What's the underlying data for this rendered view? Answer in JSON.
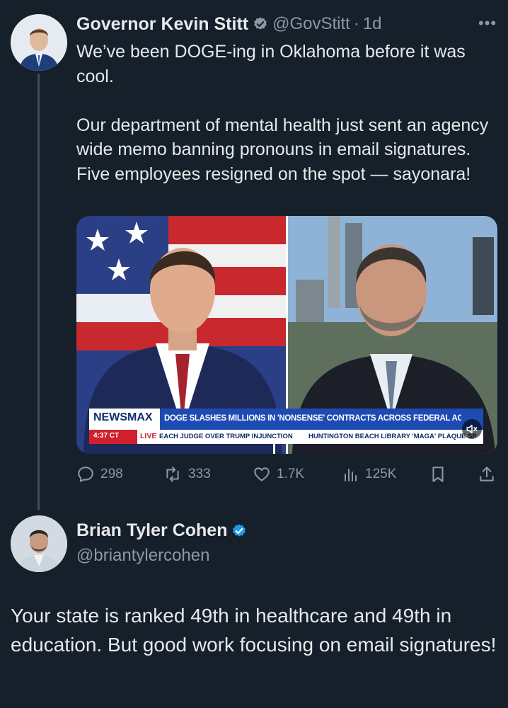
{
  "tweet1": {
    "author_name": "Governor Kevin Stitt",
    "handle": "@GovStitt",
    "separator": "·",
    "time": "1d",
    "text": "We’ve been DOGE-ing in Oklahoma before it was cool.\n\nOur department of mental health just sent an agency wide memo banning pronouns in email signatures. Five employees resigned on the spot — sayonara!",
    "media": {
      "network": "NEWSMAX",
      "headline": "DOGE SLASHES MILLIONS IN 'NONSENSE' CONTRACTS ACROSS FEDERAL AGENCIES",
      "time": "4:37 CT",
      "live": "LIVE",
      "ticker_1": "EACH JUDGE OVER TRUMP INJUNCTION",
      "ticker_2": "HUNTINGTON BEACH LIBRARY 'MAGA' PLAQUE SP"
    },
    "actions": {
      "replies": "298",
      "reposts": "333",
      "likes": "1.7K",
      "views": "125K"
    }
  },
  "tweet2": {
    "author_name": "Brian Tyler Cohen",
    "handle": "@briantylercohen",
    "text": "Your state is ranked 49th in healthcare and 49th in education. But good work focusing on email signatures!"
  },
  "colors": {
    "background": "#15202b",
    "text": "#e7e9ea",
    "muted": "#8b98a5",
    "verified": "#1d9bf0"
  }
}
